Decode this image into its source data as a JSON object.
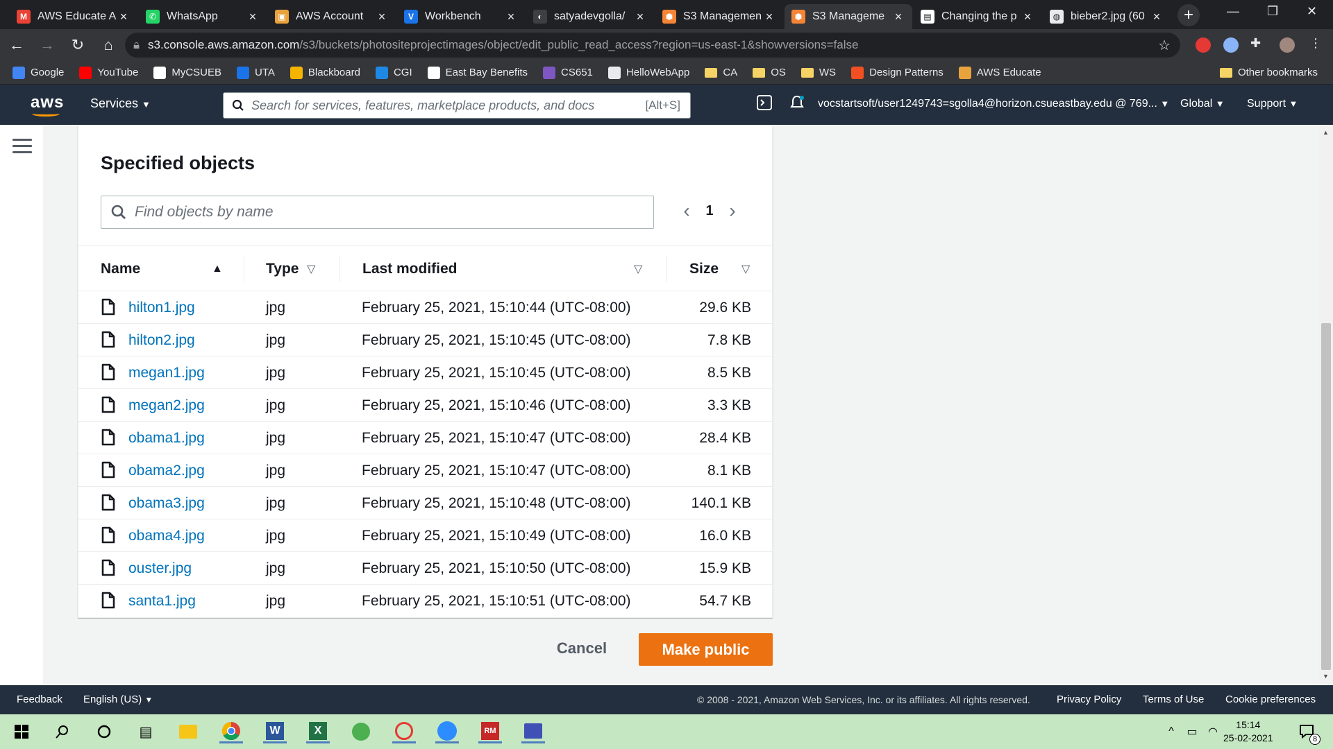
{
  "browser": {
    "tabs": [
      {
        "title": "AWS Educate A",
        "favicon_color": "#ea4335",
        "favicon_glyph": "M",
        "active": false
      },
      {
        "title": "WhatsApp",
        "favicon_color": "#25d366",
        "favicon_glyph": "✆",
        "active": false
      },
      {
        "title": "AWS Account",
        "favicon_color": "#e8a33d",
        "favicon_glyph": "▣",
        "active": false
      },
      {
        "title": "Workbench",
        "favicon_color": "#1a73e8",
        "favicon_glyph": "V",
        "active": false
      },
      {
        "title": "satyadevgolla/",
        "favicon_color": "#3c4043",
        "favicon_glyph": "◐",
        "active": false
      },
      {
        "title": "S3 Managemen",
        "favicon_color": "#f58536",
        "favicon_glyph": "⬢",
        "active": false
      },
      {
        "title": "S3 Manageme",
        "favicon_color": "#f58536",
        "favicon_glyph": "⬢",
        "active": true
      },
      {
        "title": "Changing the p",
        "favicon_color": "#ffffff",
        "favicon_glyph": "▤",
        "active": false
      },
      {
        "title": "bieber2.jpg (60",
        "favicon_color": "#e8eaed",
        "favicon_glyph": "◍",
        "active": false
      }
    ],
    "url_host": "s3.console.aws.amazon.com",
    "url_path": "/s3/buckets/photositeprojectimages/object/edit_public_read_access?region=us-east-1&showversions=false",
    "bookmarks": [
      {
        "label": "Google",
        "color": "#4285f4"
      },
      {
        "label": "YouTube",
        "color": "#ff0000"
      },
      {
        "label": "MyCSUEB",
        "color": "#ffffff"
      },
      {
        "label": "UTA",
        "color": "#1a73e8"
      },
      {
        "label": "Blackboard",
        "color": "#f4b400"
      },
      {
        "label": "CGI",
        "color": "#1e88e5"
      },
      {
        "label": "East Bay Benefits",
        "color": "#ffffff"
      },
      {
        "label": "CS651",
        "color": "#7e57c2"
      },
      {
        "label": "HelloWebApp",
        "color": "#e8eaed"
      },
      {
        "label": "CA",
        "color": "folder"
      },
      {
        "label": "OS",
        "color": "folder"
      },
      {
        "label": "WS",
        "color": "folder"
      },
      {
        "label": "Design Patterns",
        "color": "#f25022"
      },
      {
        "label": "AWS Educate",
        "color": "#e8a33d"
      }
    ],
    "other_bookmarks": "Other bookmarks"
  },
  "aws_header": {
    "logo": "aws",
    "services": "Services",
    "search_placeholder": "Search for services, features, marketplace products, and docs",
    "search_shortcut": "[Alt+S]",
    "account": "vocstartsoft/user1249743=sgolla4@horizon.csueastbay.edu @ 769...",
    "region": "Global",
    "support": "Support"
  },
  "panel": {
    "title": "Specified objects",
    "find_placeholder": "Find objects by name",
    "page": "1",
    "columns": {
      "name": "Name",
      "type": "Type",
      "last_modified": "Last modified",
      "size": "Size"
    },
    "rows": [
      {
        "name": "hilton1.jpg",
        "type": "jpg",
        "modified": "February 25, 2021, 15:10:44 (UTC-08:00)",
        "size": "29.6 KB"
      },
      {
        "name": "hilton2.jpg",
        "type": "jpg",
        "modified": "February 25, 2021, 15:10:45 (UTC-08:00)",
        "size": "7.8 KB"
      },
      {
        "name": "megan1.jpg",
        "type": "jpg",
        "modified": "February 25, 2021, 15:10:45 (UTC-08:00)",
        "size": "8.5 KB"
      },
      {
        "name": "megan2.jpg",
        "type": "jpg",
        "modified": "February 25, 2021, 15:10:46 (UTC-08:00)",
        "size": "3.3 KB"
      },
      {
        "name": "obama1.jpg",
        "type": "jpg",
        "modified": "February 25, 2021, 15:10:47 (UTC-08:00)",
        "size": "28.4 KB"
      },
      {
        "name": "obama2.jpg",
        "type": "jpg",
        "modified": "February 25, 2021, 15:10:47 (UTC-08:00)",
        "size": "8.1 KB"
      },
      {
        "name": "obama3.jpg",
        "type": "jpg",
        "modified": "February 25, 2021, 15:10:48 (UTC-08:00)",
        "size": "140.1 KB"
      },
      {
        "name": "obama4.jpg",
        "type": "jpg",
        "modified": "February 25, 2021, 15:10:49 (UTC-08:00)",
        "size": "16.0 KB"
      },
      {
        "name": "ouster.jpg",
        "type": "jpg",
        "modified": "February 25, 2021, 15:10:50 (UTC-08:00)",
        "size": "15.9 KB"
      },
      {
        "name": "santa1.jpg",
        "type": "jpg",
        "modified": "February 25, 2021, 15:10:51 (UTC-08:00)",
        "size": "54.7 KB"
      }
    ],
    "cancel": "Cancel",
    "make_public": "Make public"
  },
  "footer": {
    "feedback": "Feedback",
    "language": "English (US)",
    "copyright": "© 2008 - 2021, Amazon Web Services, Inc. or its affiliates. All rights reserved.",
    "privacy": "Privacy Policy",
    "terms": "Terms of Use",
    "cookies": "Cookie preferences"
  },
  "taskbar": {
    "time": "15:14",
    "date": "25-02-2021",
    "notification_count": "8",
    "apps": [
      "windows-start",
      "search",
      "cortana",
      "task-view",
      "file-explorer",
      "chrome",
      "word",
      "excel",
      "greenshot",
      "snipping",
      "zoom",
      "rapid-miner",
      "network-tool"
    ]
  },
  "colors": {
    "aws_navy": "#232f3e",
    "aws_orange": "#ec7211",
    "link_blue": "#0073bb"
  }
}
